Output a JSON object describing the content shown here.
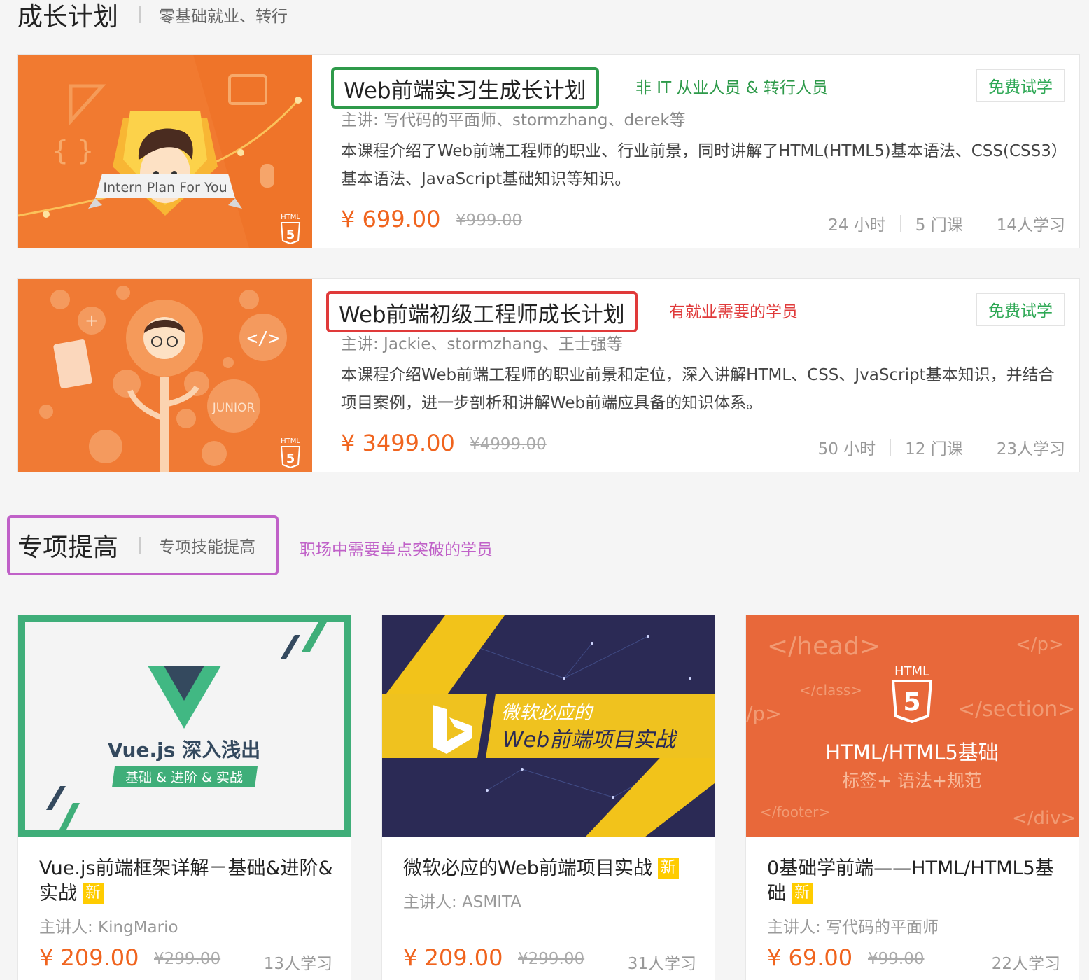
{
  "growth_section": {
    "title": "成长计划",
    "subtitle": "零基础就业、转行"
  },
  "plans": [
    {
      "cover_caption": "Intern Plan For You",
      "cover_badge": "HTML",
      "cover_badge_num": "5",
      "title": "Web前端实习生成长计划",
      "note": "非 IT 从业人员 & 转行人员",
      "trial_label": "免费试学",
      "teacher": "主讲: 写代码的平面师、stormzhang、derek等",
      "description": "本课程介绍了Web前端工程师的职业、行业前景，同时讲解了HTML(HTML5)基本语法、CSS(CSS3）基本语法、JavaScript基础知识等知识。",
      "price": "¥ 699.00",
      "original_price": "¥999.00",
      "hours": "24 小时",
      "lessons": "5 门课",
      "students": "14人学习"
    },
    {
      "cover_caption": "JUNIOR",
      "cover_badge": "HTML",
      "cover_badge_num": "5",
      "title": "Web前端初级工程师成长计划",
      "note": "有就业需要的学员",
      "trial_label": "免费试学",
      "teacher": "主讲: Jackie、stormzhang、王士强等",
      "description": "本课程介绍Web前端工程师的职业前景和定位，深入讲解HTML、CSS、JvaScript基本知识，并结合项目案例，进一步剖析和讲解Web前端应具备的知识体系。",
      "price": "¥ 3499.00",
      "original_price": "¥4999.00",
      "hours": "50 小时",
      "lessons": "12 门课",
      "students": "23人学习"
    }
  ],
  "special_section": {
    "title": "专项提高",
    "subtitle": "专项技能提高",
    "note": "职场中需要单点突破的学员"
  },
  "courses": [
    {
      "cover_title": "Vue.js 深入浅出",
      "cover_subtitle": "基础 & 进阶 & 实战",
      "title": "Vue.js前端框架详解－基础&进阶&实战",
      "badge": "新",
      "teacher": "主讲人: KingMario",
      "price": "¥ 209.00",
      "original_price": "¥299.00",
      "students": "13人学习"
    },
    {
      "cover_line1": "微软必应的",
      "cover_line2": "Web前端项目实战",
      "title": "微软必应的Web前端项目实战",
      "badge": "新",
      "teacher": "主讲人: ASMITA",
      "price": "¥ 209.00",
      "original_price": "¥299.00",
      "students": "31人学习"
    },
    {
      "cover_tags": [
        "</head>",
        "</p>",
        "</class>",
        "</section>",
        "/p>",
        "</footer>",
        "</div>"
      ],
      "cover_badge": "HTML",
      "cover_badge_num": "5",
      "cover_title": "HTML/HTML5基础",
      "cover_subtitle": "标签+ 语法+规范",
      "title": "0基础学前端——HTML/HTML5基础",
      "badge": "新",
      "teacher": "主讲人: 写代码的平面师",
      "price": "¥ 69.00",
      "original_price": "¥99.00",
      "students": "22人学习"
    }
  ],
  "colors": {
    "accent_orange": "#f0641e",
    "plan1_highlight": "#2e9a4a",
    "plan2_highlight": "#e03a3a",
    "section_highlight": "#c061c8",
    "trial_green": "#2ea855",
    "badge_yellow": "#ffcc00"
  }
}
